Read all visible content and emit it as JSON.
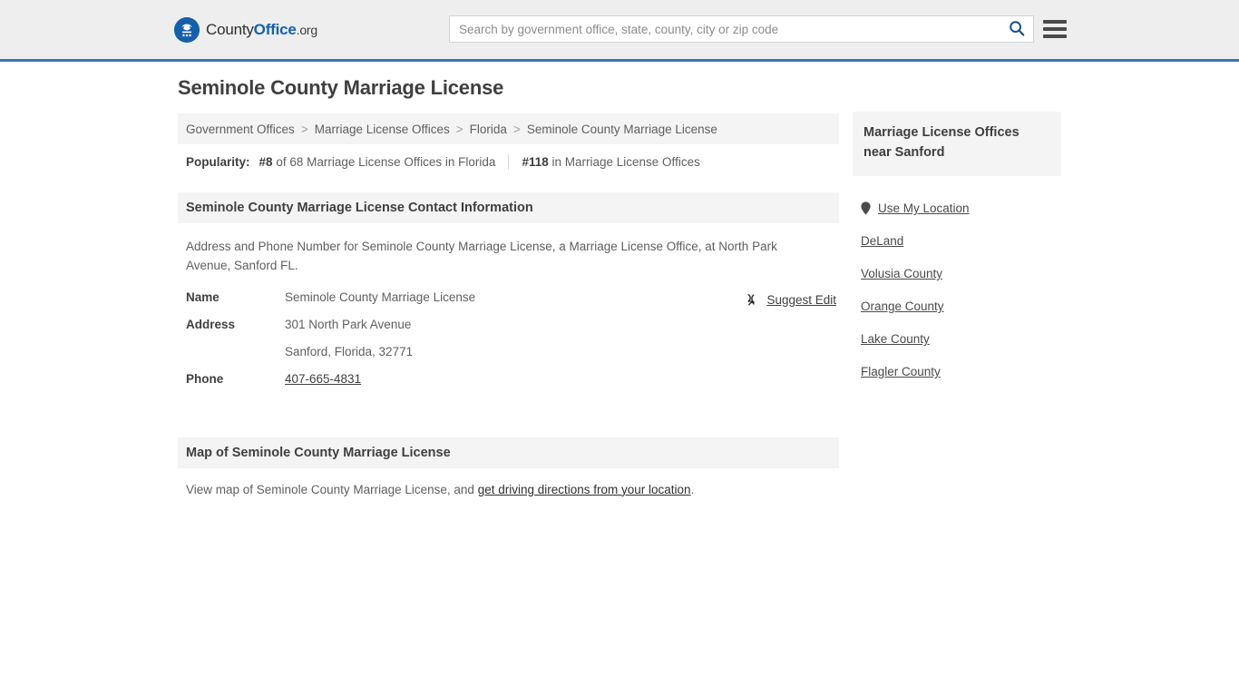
{
  "header": {
    "logo": {
      "part1": "County",
      "part2": "Office",
      "part3": ".org",
      "icon": "eagle-seal-icon"
    },
    "search": {
      "placeholder": "Search by government office, state, county, city or zip code",
      "value": "",
      "icon": "search-icon"
    },
    "menu_icon": "hamburger-menu-icon",
    "accent_color": "#3a76ab"
  },
  "main": {
    "title": "Seminole County Marriage License",
    "breadcrumb": {
      "separator": ">",
      "items": [
        {
          "label": "Government Offices",
          "current": false
        },
        {
          "label": "Marriage License Offices",
          "current": false
        },
        {
          "label": "Florida",
          "current": false
        },
        {
          "label": "Seminole County Marriage License",
          "current": true
        }
      ]
    },
    "popularity": {
      "label": "Popularity:",
      "stat1_rank": "#8",
      "stat1_text": "of 68 Marriage License Offices in Florida",
      "stat2_rank": "#118",
      "stat2_text": "in Marriage License Offices"
    },
    "contact_section": {
      "heading": "Seminole County Marriage License Contact Information",
      "description": "Address and Phone Number for Seminole County Marriage License, a Marriage License Office, at North Park Avenue, Sanford FL.",
      "suggest_edit": {
        "label": "Suggest Edit",
        "icon": "edit-pencil-icon"
      },
      "rows": [
        {
          "label": "Name",
          "value": "Seminole County Marriage License",
          "link": false
        },
        {
          "label": "Address",
          "value": "301 North Park Avenue",
          "link": false
        },
        {
          "label": "",
          "value": "Sanford, Florida, 32771",
          "link": false
        },
        {
          "label": "Phone",
          "value": "407-665-4831",
          "link": true
        }
      ]
    },
    "map_section": {
      "heading": "Map of Seminole County Marriage License",
      "text_before": "View map of Seminole County Marriage License, and ",
      "link_text": "get driving directions from your location",
      "text_after": "."
    }
  },
  "sidebar": {
    "heading": "Marriage License Offices near Sanford",
    "items": [
      {
        "label": "Use My Location",
        "icon": "map-pin-icon"
      },
      {
        "label": "DeLand",
        "icon": ""
      },
      {
        "label": "Volusia County",
        "icon": ""
      },
      {
        "label": "Orange County",
        "icon": ""
      },
      {
        "label": "Lake County",
        "icon": ""
      },
      {
        "label": "Flagler County",
        "icon": ""
      }
    ]
  }
}
